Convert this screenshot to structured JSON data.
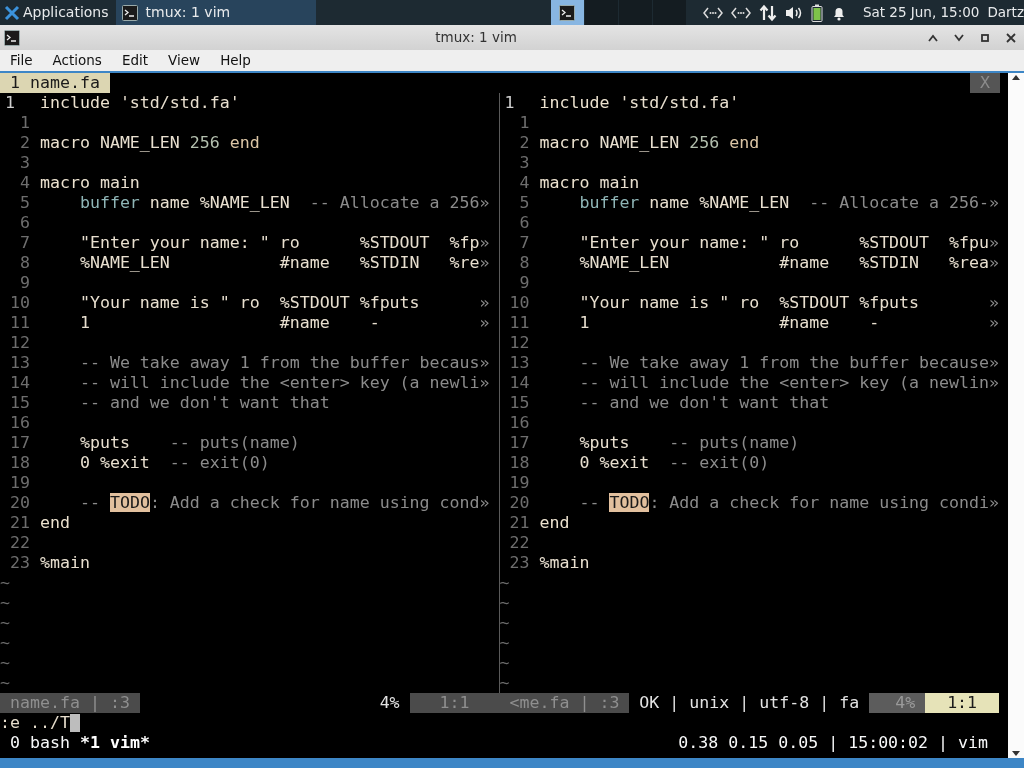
{
  "taskbar": {
    "apps_label": "Applications",
    "window_buttons": [
      {
        "title": "tmux: 1 vim",
        "selected": true
      }
    ],
    "workspaces": [
      {
        "selected": true
      },
      {
        "selected": false
      },
      {
        "selected": false
      },
      {
        "selected": false
      }
    ],
    "clock": "Sat 25 Jun, 15:00",
    "user": "Dartz"
  },
  "window": {
    "title": "tmux: 1 vim"
  },
  "menu": [
    "File",
    "Actions",
    "Edit",
    "View",
    "Help"
  ],
  "vim": {
    "tabs": [
      {
        "label": "1 name.fa",
        "selected": true
      }
    ],
    "close_label": "X",
    "panes": [
      {
        "focused": false,
        "lines": [
          {
            "kind": "code",
            "number": "1",
            "current": true,
            "segments": [
              {
                "kind": "keyword",
                "text": "include"
              },
              {
                "kind": "text",
                "text": " 'std/std.fa'"
              }
            ]
          },
          {
            "kind": "code",
            "number": "1",
            "current": false
          },
          {
            "kind": "code",
            "number": "2",
            "current": false,
            "segments": [
              {
                "kind": "keyword",
                "text": "macro"
              },
              {
                "kind": "text",
                "text": " NAME_LEN "
              },
              {
                "kind": "number",
                "text": "256"
              },
              {
                "kind": "end",
                "text": " end"
              }
            ]
          },
          {
            "kind": "code",
            "number": "3",
            "current": false
          },
          {
            "kind": "code",
            "number": "4",
            "current": false,
            "segments": [
              {
                "kind": "keyword",
                "text": "macro"
              },
              {
                "kind": "text",
                "text": " main"
              }
            ]
          },
          {
            "kind": "code",
            "number": "5",
            "current": false,
            "segments": [
              {
                "kind": "type",
                "text": "    buffer"
              },
              {
                "kind": "text",
                "text": " name %NAME_LEN  "
              },
              {
                "kind": "comment",
                "text": "-- Allocate a 256»"
              }
            ]
          },
          {
            "kind": "code",
            "number": "6",
            "current": false
          },
          {
            "kind": "code",
            "number": "7",
            "current": false,
            "segments": [
              {
                "kind": "text",
                "text": "    \"Enter your name: \" ro      %STDOUT  %fp"
              },
              {
                "kind": "comment",
                "text": "»"
              }
            ]
          },
          {
            "kind": "code",
            "number": "8",
            "current": false,
            "segments": [
              {
                "kind": "text",
                "text": "    %NAME_LEN           #name   %STDIN   %re"
              },
              {
                "kind": "comment",
                "text": "»"
              }
            ]
          },
          {
            "kind": "code",
            "number": "9",
            "current": false
          },
          {
            "kind": "code",
            "number": "10",
            "current": false,
            "segments": [
              {
                "kind": "text",
                "text": "    \"Your name is \" ro  %STDOUT %fputs"
              },
              {
                "kind": "comment",
                "text": "      »"
              }
            ]
          },
          {
            "kind": "code",
            "number": "11",
            "current": false,
            "segments": [
              {
                "kind": "text",
                "text": "    1                   #name    -"
              },
              {
                "kind": "comment",
                "text": "          »"
              }
            ]
          },
          {
            "kind": "code",
            "number": "12",
            "current": false
          },
          {
            "kind": "code",
            "number": "13",
            "current": false,
            "segments": [
              {
                "kind": "comment",
                "text": "    -- We take away 1 from the buffer becaus»"
              }
            ]
          },
          {
            "kind": "code",
            "number": "14",
            "current": false,
            "segments": [
              {
                "kind": "comment",
                "text": "    -- will include the <enter> key (a newli»"
              }
            ]
          },
          {
            "kind": "code",
            "number": "15",
            "current": false,
            "segments": [
              {
                "kind": "comment",
                "text": "    -- and we don't want that"
              }
            ]
          },
          {
            "kind": "code",
            "number": "16",
            "current": false
          },
          {
            "kind": "code",
            "number": "17",
            "current": false,
            "segments": [
              {
                "kind": "text",
                "text": "    %puts    "
              },
              {
                "kind": "comment",
                "text": "-- puts(name)"
              }
            ]
          },
          {
            "kind": "code",
            "number": "18",
            "current": false,
            "segments": [
              {
                "kind": "text",
                "text": "    0 %exit  "
              },
              {
                "kind": "comment",
                "text": "-- exit(0)"
              }
            ]
          },
          {
            "kind": "code",
            "number": "19",
            "current": false
          },
          {
            "kind": "code",
            "number": "20",
            "current": false,
            "segments": [
              {
                "kind": "comment",
                "text": "    -- "
              },
              {
                "kind": "todo",
                "text": "TODO"
              },
              {
                "kind": "comment",
                "text": ": Add a check for name using cond»"
              }
            ]
          },
          {
            "kind": "code",
            "number": "21",
            "current": false,
            "segments": [
              {
                "kind": "keyword",
                "text": "end"
              }
            ]
          },
          {
            "kind": "code",
            "number": "22",
            "current": false
          },
          {
            "kind": "code",
            "number": "23",
            "current": false,
            "segments": [
              {
                "kind": "text",
                "text": "%main"
              }
            ]
          },
          {
            "kind": "filler",
            "text": "~"
          },
          {
            "kind": "filler",
            "text": "~"
          },
          {
            "kind": "filler",
            "text": "~"
          },
          {
            "kind": "filler",
            "text": "~"
          },
          {
            "kind": "filler",
            "text": "~"
          },
          {
            "kind": "filler",
            "text": "~"
          }
        ],
        "status": [
          {
            "kind": "file",
            "text": "name.fa | :3"
          },
          {
            "kind": "percent",
            "text": "4%"
          },
          {
            "kind": "position",
            "text": "1:1"
          }
        ]
      },
      {
        "focused": true,
        "lines": [
          {
            "kind": "code",
            "number": "1",
            "current": true,
            "segments": [
              {
                "kind": "keyword",
                "text": "include"
              },
              {
                "kind": "text",
                "text": " 'std/std.fa'"
              }
            ]
          },
          {
            "kind": "code",
            "number": "1",
            "current": false
          },
          {
            "kind": "code",
            "number": "2",
            "current": false,
            "segments": [
              {
                "kind": "keyword",
                "text": "macro"
              },
              {
                "kind": "text",
                "text": " NAME_LEN "
              },
              {
                "kind": "number",
                "text": "256"
              },
              {
                "kind": "end",
                "text": " end"
              }
            ]
          },
          {
            "kind": "code",
            "number": "3",
            "current": false
          },
          {
            "kind": "code",
            "number": "4",
            "current": false,
            "segments": [
              {
                "kind": "keyword",
                "text": "macro"
              },
              {
                "kind": "text",
                "text": " main"
              }
            ]
          },
          {
            "kind": "code",
            "number": "5",
            "current": false,
            "segments": [
              {
                "kind": "type",
                "text": "    buffer"
              },
              {
                "kind": "text",
                "text": " name %NAME_LEN  "
              },
              {
                "kind": "comment",
                "text": "-- Allocate a 256-»"
              }
            ]
          },
          {
            "kind": "code",
            "number": "6",
            "current": false
          },
          {
            "kind": "code",
            "number": "7",
            "current": false,
            "segments": [
              {
                "kind": "text",
                "text": "    \"Enter your name: \" ro      %STDOUT  %fpu"
              },
              {
                "kind": "comment",
                "text": "»"
              }
            ]
          },
          {
            "kind": "code",
            "number": "8",
            "current": false,
            "segments": [
              {
                "kind": "text",
                "text": "    %NAME_LEN           #name   %STDIN   %rea"
              },
              {
                "kind": "comment",
                "text": "»"
              }
            ]
          },
          {
            "kind": "code",
            "number": "9",
            "current": false
          },
          {
            "kind": "code",
            "number": "10",
            "current": false,
            "segments": [
              {
                "kind": "text",
                "text": "    \"Your name is \" ro  %STDOUT %fputs"
              },
              {
                "kind": "comment",
                "text": "       »"
              }
            ]
          },
          {
            "kind": "code",
            "number": "11",
            "current": false,
            "segments": [
              {
                "kind": "text",
                "text": "    1                   #name    -"
              },
              {
                "kind": "comment",
                "text": "           »"
              }
            ]
          },
          {
            "kind": "code",
            "number": "12",
            "current": false
          },
          {
            "kind": "code",
            "number": "13",
            "current": false,
            "segments": [
              {
                "kind": "comment",
                "text": "    -- We take away 1 from the buffer because»"
              }
            ]
          },
          {
            "kind": "code",
            "number": "14",
            "current": false,
            "segments": [
              {
                "kind": "comment",
                "text": "    -- will include the <enter> key (a newlin»"
              }
            ]
          },
          {
            "kind": "code",
            "number": "15",
            "current": false,
            "segments": [
              {
                "kind": "comment",
                "text": "    -- and we don't want that"
              }
            ]
          },
          {
            "kind": "code",
            "number": "16",
            "current": false
          },
          {
            "kind": "code",
            "number": "17",
            "current": false,
            "segments": [
              {
                "kind": "text",
                "text": "    %puts    "
              },
              {
                "kind": "comment",
                "text": "-- puts(name)"
              }
            ]
          },
          {
            "kind": "code",
            "number": "18",
            "current": false,
            "segments": [
              {
                "kind": "text",
                "text": "    0 %exit  "
              },
              {
                "kind": "comment",
                "text": "-- exit(0)"
              }
            ]
          },
          {
            "kind": "code",
            "number": "19",
            "current": false
          },
          {
            "kind": "code",
            "number": "20",
            "current": false,
            "segments": [
              {
                "kind": "comment",
                "text": "    -- "
              },
              {
                "kind": "todo",
                "text": "TODO"
              },
              {
                "kind": "comment",
                "text": ": Add a check for name using condi»"
              }
            ]
          },
          {
            "kind": "code",
            "number": "21",
            "current": false,
            "segments": [
              {
                "kind": "keyword",
                "text": "end"
              }
            ]
          },
          {
            "kind": "code",
            "number": "22",
            "current": false
          },
          {
            "kind": "code",
            "number": "23",
            "current": false,
            "segments": [
              {
                "kind": "text",
                "text": "%main"
              }
            ]
          },
          {
            "kind": "filler",
            "text": "~"
          },
          {
            "kind": "filler",
            "text": "~"
          },
          {
            "kind": "filler",
            "text": "~"
          },
          {
            "kind": "filler",
            "text": "~"
          },
          {
            "kind": "filler",
            "text": "~"
          },
          {
            "kind": "filler",
            "text": "~"
          }
        ],
        "status": [
          {
            "kind": "file",
            "text": "<me.fa | :3"
          },
          {
            "kind": "info",
            "text": "OK | unix | utf-8 | fa"
          },
          {
            "kind": "percent",
            "text": "4%"
          },
          {
            "kind": "position",
            "text": "1:1"
          }
        ]
      }
    ],
    "command_line": ":e ../T"
  },
  "tmux": {
    "windows": [
      {
        "label": "0 bash",
        "selected": false
      },
      {
        "label": "*1 vim*",
        "selected": true
      }
    ],
    "status_right": "0.38 0.15 0.05 | 15:00:02 | vim"
  }
}
